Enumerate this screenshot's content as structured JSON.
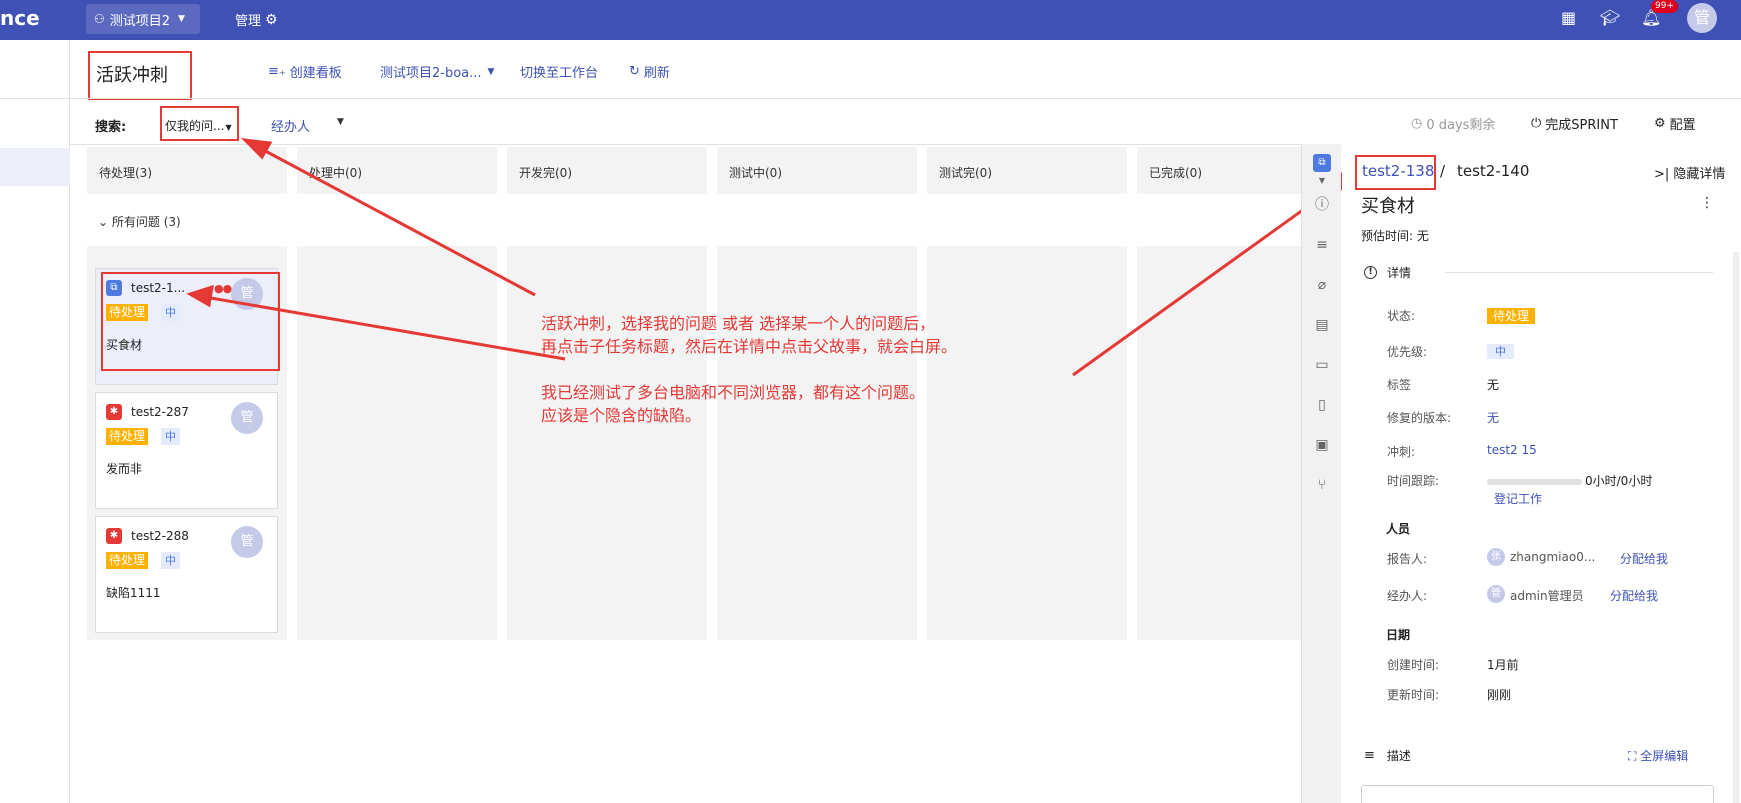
{
  "topbar": {
    "brand": "nce",
    "project": "测试项目2",
    "manage": "管理",
    "notification_badge": "99+",
    "user_avatar": "管",
    "icons": [
      "apps-grid-icon",
      "graduation-cap-icon",
      "bell-icon"
    ],
    "bg_color": "#3f51b5"
  },
  "header": {
    "sprint_title": "活跃冲刺",
    "create_board": "创建看板",
    "board_select": "测试项目2-boa...",
    "switch_workbench": "切换至工作台",
    "refresh": "刷新"
  },
  "filters": {
    "search_label": "搜索:",
    "mine_filter": "仅我的问...",
    "assignee_filter": "经办人",
    "days_left": "0 days剩余",
    "complete_sprint": "完成SPRINT",
    "config": "配置"
  },
  "board": {
    "columns": [
      {
        "name": "待处理(3)"
      },
      {
        "name": "处理中(0)"
      },
      {
        "name": "开发完(0)"
      },
      {
        "name": "测试中(0)"
      },
      {
        "name": "测试完(0)"
      },
      {
        "name": "已完成(0)"
      }
    ],
    "swimlane": "所有问题 (3)",
    "cards": [
      {
        "key": "test2-1...",
        "status": "待处理",
        "priority": "中",
        "summary": "买食材",
        "avatar": "管",
        "type": "subtask"
      },
      {
        "key": "test2-287",
        "status": "待处理",
        "priority": "中",
        "summary": "发而非",
        "avatar": "管",
        "type": "bug"
      },
      {
        "key": "test2-288",
        "status": "待处理",
        "priority": "中",
        "summary": "缺陷1111",
        "avatar": "管",
        "type": "bug"
      }
    ]
  },
  "annotation": {
    "lines": [
      "活跃冲刺，选择我的问题 或者 选择某一个人的问题后，",
      "再点击子任务标题，然后在详情中点击父故事，就会白屏。",
      "我已经测试了多台电脑和不同浏览器，都有这个问题。",
      "应该是个隐含的缺陷。"
    ],
    "color": "#e53935"
  },
  "detail": {
    "parent_key": "test2-138",
    "separator": "/",
    "child_key": "test2-140",
    "hide_detail": "隐藏详情",
    "title": "买食材",
    "estimate": "预估时间: 无",
    "details_heading": "详情",
    "fields": {
      "status_label": "状态:",
      "status_value": "待处理",
      "priority_label": "优先级:",
      "priority_value": "中",
      "tags_label": "标签",
      "tags_value": "无",
      "fix_version_label": "修复的版本:",
      "fix_version_value": "无",
      "sprint_label": "冲刺:",
      "sprint_value": "test2 15",
      "time_label": "时间跟踪:",
      "time_value": "0小时/0小时",
      "log_work": "登记工作"
    },
    "people_heading": "人员",
    "reporter_label": "报告人:",
    "reporter_avatar": "张",
    "reporter_name": "zhangmiao0...",
    "assignee_label": "经办人:",
    "assignee_avatar": "管",
    "assignee_name": "admin管理员",
    "assign_to_me": "分配给我",
    "dates_heading": "日期",
    "created_label": "创建时间:",
    "created_value": "1月前",
    "updated_label": "更新时间:",
    "updated_value": "刚刚",
    "description_heading": "描述",
    "fullscreen_edit": "全屏编辑"
  }
}
